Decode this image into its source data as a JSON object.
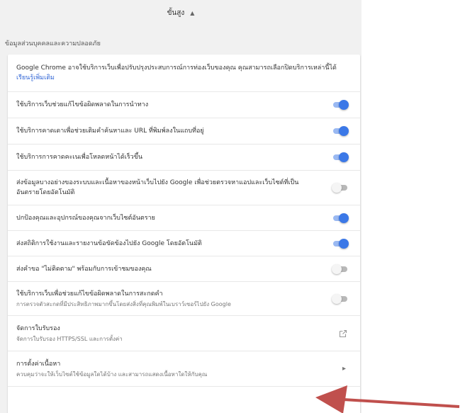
{
  "header": {
    "advanced_label": "ขั้นสูง"
  },
  "section": {
    "title": "ข้อมูลส่วนบุคคลและความปลอดภัย"
  },
  "intro": {
    "text": "Google Chrome อาจใช้บริการเว็บเพื่อปรับปรุงประสบการณ์การท่องเว็บของคุณ คุณสามารถเลือกปิดบริการเหล่านี้ได้ ",
    "link": "เรียนรู้เพิ่มเติม"
  },
  "settings": [
    {
      "label": "ใช้บริการเว็บช่วยแก้ไขข้อผิดพลาดในการนำทาง",
      "state": "on"
    },
    {
      "label": "ใช้บริการคาดเดาเพื่อช่วยเติมคำค้นหาและ URL ที่พิมพ์ลงในแถบที่อยู่",
      "state": "on"
    },
    {
      "label": "ใช้บริการการคาดคะเนเพื่อโหลดหน้าได้เร็วขึ้น",
      "state": "on"
    },
    {
      "label": "ส่งข้อมูลบางอย่างของระบบและเนื้อหาของหน้าเว็บไปยัง Google เพื่อช่วยตรวจหาแอปและเว็บไซต์ที่เป็นอันตรายโดยอัตโนมัติ",
      "state": "off"
    },
    {
      "label": "ปกป้องคุณและอุปกรณ์ของคุณจากเว็บไซต์อันตราย",
      "state": "on"
    },
    {
      "label": "ส่งสถิติการใช้งานและรายงานข้อขัดข้องไปยัง Google โดยอัตโนมัติ",
      "state": "on"
    },
    {
      "label": "ส่งคำขอ \"ไม่ติดตาม\" พร้อมกับการเข้าชมของคุณ",
      "state": "off"
    },
    {
      "label": "ใช้บริการเว็บเพื่อช่วยแก้ไขข้อผิดพลาดในการสะกดคำ",
      "sub": "การตรวจตัวสะกดที่มีประสิทธิภาพมากขึ้นโดยส่งสิ่งที่คุณพิมพ์ในเบราว์เซอร์ไปยัง Google",
      "state": "off"
    }
  ],
  "certificates": {
    "label": "จัดการใบรับรอง",
    "sub": "จัดการใบรับรอง HTTPS/SSL และการตั้งค่า"
  },
  "content_settings": {
    "label": "การตั้งค่าเนื้อหา",
    "sub": "ควบคุมว่าจะให้เว็บไซต์ใช้ข้อมูลใดได้บ้าง และสามารถแสดงเนื้อหาใดให้กับคุณ"
  },
  "colors": {
    "accent": "#3b78e7",
    "annotation_arrow": "#c0504d"
  }
}
